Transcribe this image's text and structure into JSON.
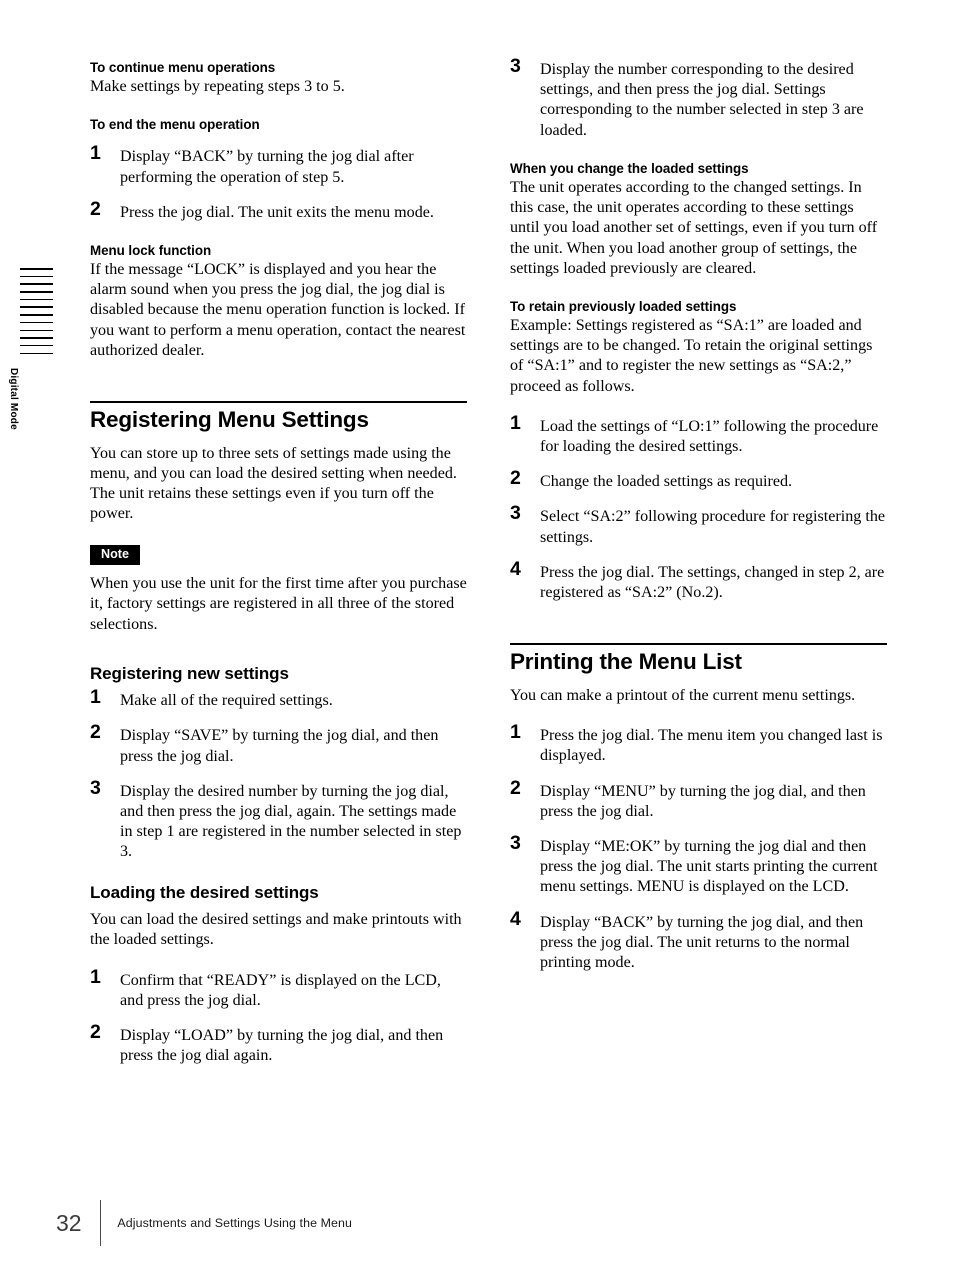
{
  "side_tab": {
    "label": "Digital Mode",
    "stripe_count": 12
  },
  "footer": {
    "page_number": "32",
    "text": "Adjustments and Settings Using the Menu"
  },
  "left_column": {
    "h_continue": "To continue menu operations",
    "p_continue": "Make settings by repeating steps 3 to 5.",
    "h_end": "To end the menu operation",
    "end_steps": [
      {
        "num": "1",
        "text": "Display “BACK” by turning the jog dial after performing the operation of step 5."
      },
      {
        "num": "2",
        "text": "Press the jog dial. The unit exits the menu mode."
      }
    ],
    "h_lock": "Menu lock function",
    "p_lock": "If the message “LOCK” is displayed and you hear the alarm sound when you press the jog dial, the jog dial is disabled because the menu operation function is locked. If you want to perform a menu operation, contact the nearest authorized dealer.",
    "section_registering": {
      "title": "Registering Menu Settings",
      "intro": "You can store up to three sets of settings made using the menu, and you can load the desired setting when needed. The unit retains these settings even if you turn off the power.",
      "note_label": "Note",
      "note_text": "When you use the unit for the first time after you purchase it, factory settings are registered in all three of the stored selections.",
      "sub_new": "Registering new settings",
      "new_steps": [
        {
          "num": "1",
          "text": "Make all of the required settings."
        },
        {
          "num": "2",
          "text": "Display “SAVE” by turning the jog dial, and then press the jog dial."
        },
        {
          "num": "3",
          "text": "Display the desired number by turning the jog dial, and then press the jog dial, again. The settings made in step 1 are registered in the number selected in step 3."
        }
      ],
      "sub_loading": "Loading the desired settings",
      "loading_intro": "You can load the desired settings and make printouts with the loaded settings.",
      "loading_steps": [
        {
          "num": "1",
          "text": "Confirm that “READY” is displayed on the LCD, and press the jog dial."
        },
        {
          "num": "2",
          "text": "Display “LOAD” by turning the jog dial, and then press the jog dial again."
        }
      ]
    }
  },
  "right_column": {
    "loading_step3": {
      "num": "3",
      "text": "Display the number corresponding to the desired settings, and then press the jog dial. Settings corresponding to the number selected in step 3 are loaded."
    },
    "h_change": "When you change the loaded settings",
    "p_change": "The unit operates according to the changed settings. In this case, the unit operates according to these settings until you load another set of settings, even if you turn off the unit. When you load another group of settings, the settings loaded previously are cleared.",
    "h_retain": "To retain previously loaded settings",
    "p_retain": "Example: Settings registered as “SA:1” are loaded and settings are to be changed. To retain the original settings of “SA:1” and to register the new settings as “SA:2,” proceed as follows.",
    "retain_steps": [
      {
        "num": "1",
        "text": "Load the settings of “LO:1” following the procedure for loading the desired settings."
      },
      {
        "num": "2",
        "text": "Change the loaded settings as required."
      },
      {
        "num": "3",
        "text": "Select “SA:2” following procedure for registering the settings."
      },
      {
        "num": "4",
        "text": "Press the jog dial. The settings, changed in step 2, are registered as “SA:2” (No.2)."
      }
    ],
    "section_printing": {
      "title": "Printing the Menu List",
      "intro": "You can make a printout of the current menu settings.",
      "steps": [
        {
          "num": "1",
          "text": "Press the jog dial. The menu item you changed last is displayed."
        },
        {
          "num": "2",
          "text": "Display “MENU” by turning the jog dial, and then press the jog dial."
        },
        {
          "num": "3",
          "text": "Display “ME:OK” by turning the jog dial and then press the jog dial. The unit starts printing the current menu settings. MENU is displayed on the LCD."
        },
        {
          "num": "4",
          "text": "Display “BACK” by turning the jog dial, and then press the jog dial. The unit returns to the normal printing mode."
        }
      ]
    }
  }
}
